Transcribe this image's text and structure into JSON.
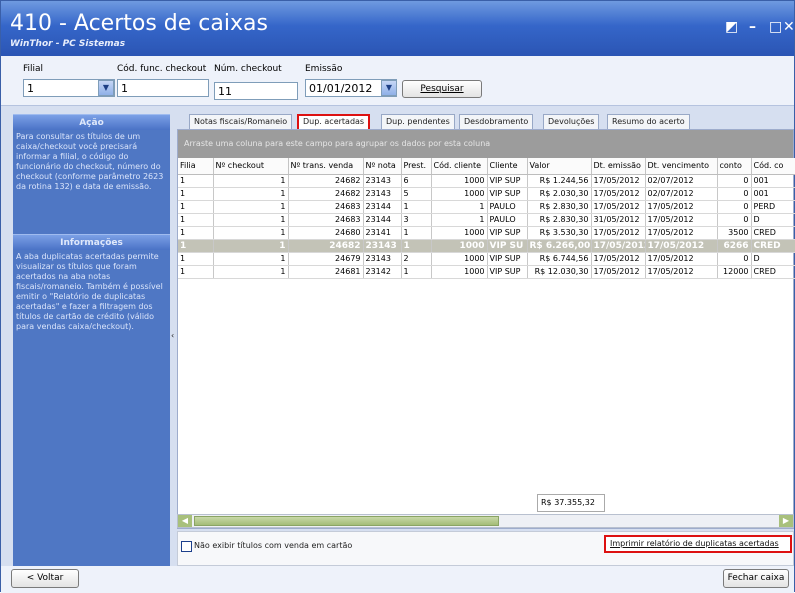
{
  "window": {
    "title": "410 - Acertos de caixas",
    "subtitle": "WinThor - PC Sistemas"
  },
  "filters": {
    "filial_label": "Filial",
    "filial_value": "1",
    "cod_func_label": "Cód. func. checkout",
    "cod_func_value": "1",
    "num_checkout_label": "Núm. checkout",
    "num_checkout_value": "11",
    "emissao_label": "Emissão",
    "emissao_value": "01/01/2012",
    "search_button": "Pesquisar"
  },
  "sidebar": {
    "acao_title": "Ação",
    "acao_text": "Para consultar os títulos de um caixa/checkout você precisará informar a filial, o código do funcionário do checkout, número do checkout (conforme parâmetro 2623 da rotina 132) e data de emissão.",
    "info_title": "Informações",
    "info_text": "A aba duplicatas acertadas permite visualizar os títulos que foram acertados na aba notas fiscais/romaneio. Também é possível emitir o \"Relatório de duplicatas acertadas\" e fazer a filtragem dos títulos de cartão de crédito (válido para vendas caixa/checkout)."
  },
  "tabs": [
    {
      "label": "Notas fiscais/Romaneio"
    },
    {
      "label": "Dup. acertadas"
    },
    {
      "label": "Dup. pendentes"
    },
    {
      "label": "Desdobramento"
    },
    {
      "label": "Devoluções"
    },
    {
      "label": "Resumo do acerto"
    }
  ],
  "grid": {
    "group_hint": "Arraste uma coluna para este campo para agrupar os dados por esta coluna",
    "columns": [
      "Filia",
      "Nº checkout",
      "Nº trans. venda",
      "Nº nota",
      "Prest.",
      "Cód. cliente",
      "Cliente",
      "Valor",
      "Dt. emissão",
      "Dt. vencimento",
      "conto",
      "Cód. co"
    ],
    "rows": [
      [
        "1",
        "1",
        "24682",
        "23143",
        "6",
        "1000",
        "VIP SUP",
        "R$ 1.244,56",
        "17/05/2012",
        "02/07/2012",
        "0",
        "001"
      ],
      [
        "1",
        "1",
        "24682",
        "23143",
        "5",
        "1000",
        "VIP SUP",
        "R$ 2.030,30",
        "17/05/2012",
        "02/07/2012",
        "0",
        "001"
      ],
      [
        "1",
        "1",
        "24683",
        "23144",
        "1",
        "1",
        "PAULO",
        "R$ 2.830,30",
        "17/05/2012",
        "17/05/2012",
        "0",
        "PERD"
      ],
      [
        "1",
        "1",
        "24683",
        "23144",
        "3",
        "1",
        "PAULO",
        "R$ 2.830,30",
        "31/05/2012",
        "17/05/2012",
        "0",
        "D"
      ],
      [
        "1",
        "1",
        "24680",
        "23141",
        "1",
        "1000",
        "VIP SUP",
        "R$ 3.530,30",
        "17/05/2012",
        "17/05/2012",
        "3500",
        "CRED"
      ],
      [
        "1",
        "1",
        "24682",
        "23143",
        "1",
        "1000",
        "VIP SU",
        "R$ 6.266,00",
        "17/05/2012",
        "17/05/2012",
        "6266",
        "CRED"
      ],
      [
        "1",
        "1",
        "24679",
        "23143",
        "2",
        "1000",
        "VIP SUP",
        "R$ 6.744,56",
        "17/05/2012",
        "17/05/2012",
        "0",
        "D"
      ],
      [
        "1",
        "1",
        "24681",
        "23142",
        "1",
        "1000",
        "VIP SUP",
        "R$ 12.030,30",
        "17/05/2012",
        "17/05/2012",
        "12000",
        "CRED"
      ]
    ],
    "total": "R$ 37.355,32"
  },
  "options": {
    "hide_card_label": "Não exibir títulos com venda em cartão",
    "print_label": "Imprimir relatório de duplicatas acertadas"
  },
  "footer": {
    "back_button": "< Voltar",
    "close_button": "Fechar caixa"
  },
  "colors": {
    "title_blue": "#3566c9",
    "panel_blue": "#4f77c4",
    "highlight_red": "#dd1111"
  }
}
